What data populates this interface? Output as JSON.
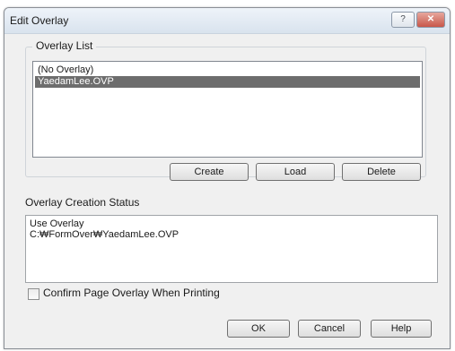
{
  "window": {
    "title": "Edit Overlay",
    "help_label": "?",
    "close_label": "✕"
  },
  "overlay_list": {
    "group_label": "Overlay List",
    "items": [
      "(No Overlay)",
      "YaedamLee.OVP"
    ],
    "selected_index": 1,
    "buttons": {
      "create": "Create",
      "load": "Load",
      "delete": "Delete"
    }
  },
  "status": {
    "label": "Overlay Creation Status",
    "lines": [
      "Use Overlay",
      "C:₩FormOver₩YaedamLee.OVP"
    ]
  },
  "confirm": {
    "label": "Confirm Page Overlay When Printing",
    "checked": false
  },
  "footer": {
    "ok": "OK",
    "cancel": "Cancel",
    "help": "Help"
  }
}
